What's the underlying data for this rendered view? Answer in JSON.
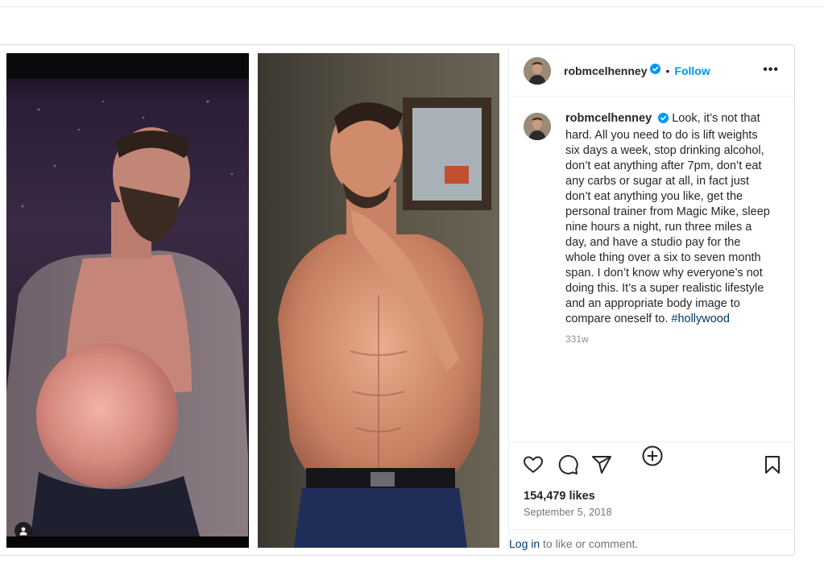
{
  "post": {
    "username": "robmcelhenney",
    "follow_label": "Follow",
    "separator": "•",
    "more_label": "•••",
    "caption": "Look, it’s not that hard. All you need to do is lift weights six days a week, stop drinking alcohol, don’t eat anything after 7pm, don’t eat any carbs or sugar at all, in fact just don’t eat anything you like, get the personal trainer from Magic Mike, sleep nine hours a night, run three miles a day, and have a studio pay for the whole thing over a six to seven month span. I don’t know why everyone’s not doing this. It’s a super realistic lifestyle and an appropriate body image to compare oneself to.",
    "hashtag": "#hollywood",
    "time_ago": "331w",
    "likes": "154,479 likes",
    "date": "September 5, 2018",
    "login_link": "Log in",
    "login_rest": " to like or comment."
  },
  "icons": {
    "verified": "verified-badge-icon",
    "like": "heart-icon",
    "comment": "comment-icon",
    "share": "send-icon",
    "save": "bookmark-icon",
    "add_comment": "plus-circle-icon",
    "user_tag": "user-tag-icon"
  },
  "colors": {
    "accent": "#0095f6",
    "hashtag": "#00376b",
    "muted": "#737373",
    "text": "#262626"
  }
}
